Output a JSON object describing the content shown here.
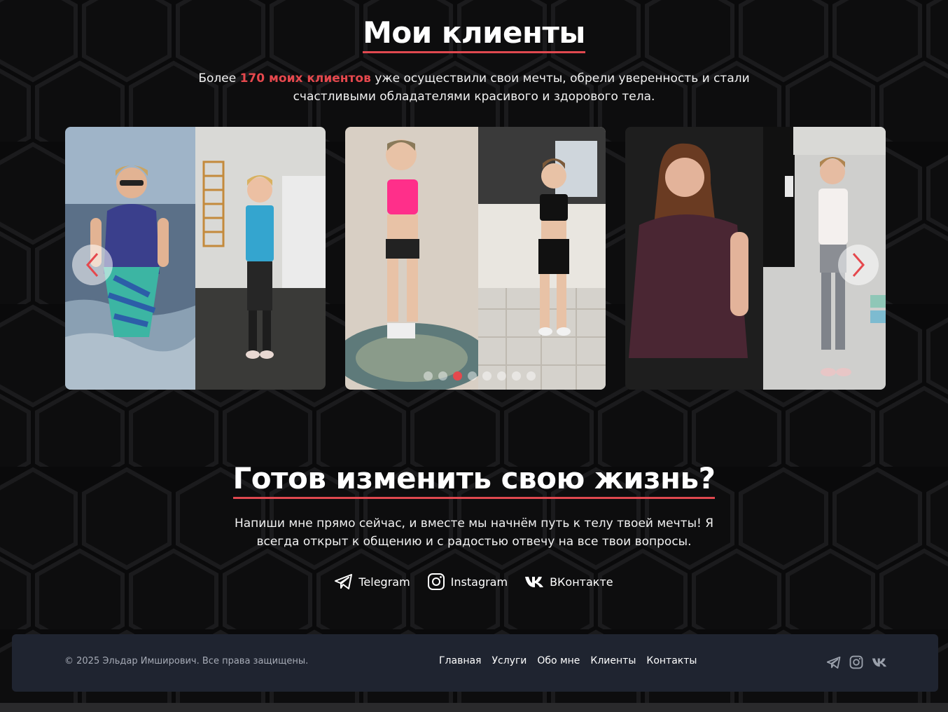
{
  "clients": {
    "title": "Мои клиенты",
    "lead_before": "Более ",
    "lead_accent": "170 моих клиентов",
    "lead_after": " уже осуществили свои мечты, обрели уверенность и стали",
    "lead_line2": "счастливыми обладателями красивого и здорового тела.",
    "slides_total": 8,
    "active_slide": 3
  },
  "cta": {
    "title": "Готов изменить свою жизнь?",
    "line1": "Напиши мне прямо сейчас, и вместе мы начнём путь к телу твоей мечты! Я",
    "line2": "всегда открыт к общению и с радостью отвечу на все твои вопросы."
  },
  "social": [
    {
      "label": "Telegram",
      "icon": "telegram-icon"
    },
    {
      "label": "Instagram",
      "icon": "instagram-icon"
    },
    {
      "label": "ВКонтакте",
      "icon": "vk-icon"
    }
  ],
  "footer": {
    "copyright": "© 2025 Эльдар Имширович. Все права защищены.",
    "nav": [
      "Главная",
      "Услуги",
      "Обо мне",
      "Клиенты",
      "Контакты"
    ],
    "icons": [
      "telegram-icon",
      "instagram-icon",
      "vk-icon"
    ]
  },
  "colors": {
    "accent": "#e5484d",
    "background": "#0a0a0b",
    "footer": "#1f2430"
  }
}
